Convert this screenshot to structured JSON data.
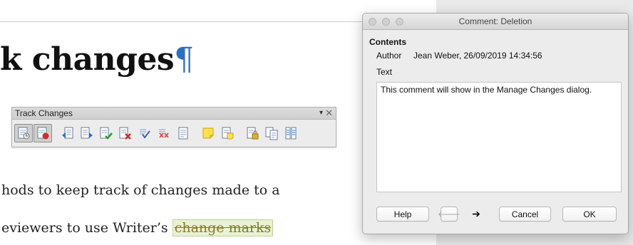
{
  "document": {
    "heading_text": "k changes",
    "pilcrow": "¶",
    "line1": "hods to keep track of changes made to a",
    "line2_prefix": "eviewers to use Writer’s ",
    "line2_tracked": "change marks"
  },
  "toolbar": {
    "title": "Track Changes",
    "menu_glyph": "▾",
    "close_glyph": "✕",
    "icons": [
      "record-changes-icon",
      "show-changes-icon",
      "previous-change-icon",
      "next-change-icon",
      "accept-change-icon",
      "reject-change-icon",
      "accept-all-icon",
      "reject-all-icon",
      "manage-changes-icon",
      "insert-comment-icon",
      "comment-change-icon",
      "protect-changes-icon",
      "compare-document-icon",
      "merge-document-icon"
    ]
  },
  "dialog": {
    "title": "Comment: Deletion",
    "section": "Contents",
    "author_label": "Author",
    "author_value": "Jean Weber, 26/09/2019 14:34:56",
    "text_label": "Text",
    "comment_text": "This comment will show in the Manage Changes dialog.",
    "buttons": {
      "help": "Help",
      "prev": "🡐",
      "next": "➔",
      "cancel": "Cancel",
      "ok": "OK"
    }
  },
  "colors": {
    "pilcrow": "#2b6fc4",
    "tracked_text": "#8a7a1e",
    "tracked_bg": "#e9f2d6"
  }
}
